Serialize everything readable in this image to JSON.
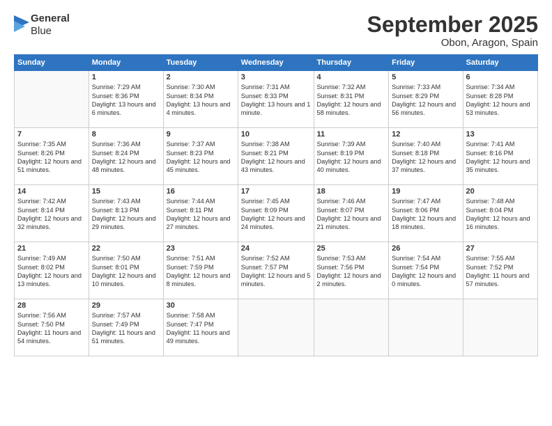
{
  "logo": {
    "line1": "General",
    "line2": "Blue"
  },
  "title": "September 2025",
  "subtitle": "Obon, Aragon, Spain",
  "days": [
    "Sunday",
    "Monday",
    "Tuesday",
    "Wednesday",
    "Thursday",
    "Friday",
    "Saturday"
  ],
  "weeks": [
    [
      {
        "day": "",
        "sunrise": "",
        "sunset": "",
        "daylight": ""
      },
      {
        "day": "1",
        "sunrise": "Sunrise: 7:29 AM",
        "sunset": "Sunset: 8:36 PM",
        "daylight": "Daylight: 13 hours and 6 minutes."
      },
      {
        "day": "2",
        "sunrise": "Sunrise: 7:30 AM",
        "sunset": "Sunset: 8:34 PM",
        "daylight": "Daylight: 13 hours and 4 minutes."
      },
      {
        "day": "3",
        "sunrise": "Sunrise: 7:31 AM",
        "sunset": "Sunset: 8:33 PM",
        "daylight": "Daylight: 13 hours and 1 minute."
      },
      {
        "day": "4",
        "sunrise": "Sunrise: 7:32 AM",
        "sunset": "Sunset: 8:31 PM",
        "daylight": "Daylight: 12 hours and 58 minutes."
      },
      {
        "day": "5",
        "sunrise": "Sunrise: 7:33 AM",
        "sunset": "Sunset: 8:29 PM",
        "daylight": "Daylight: 12 hours and 56 minutes."
      },
      {
        "day": "6",
        "sunrise": "Sunrise: 7:34 AM",
        "sunset": "Sunset: 8:28 PM",
        "daylight": "Daylight: 12 hours and 53 minutes."
      }
    ],
    [
      {
        "day": "7",
        "sunrise": "Sunrise: 7:35 AM",
        "sunset": "Sunset: 8:26 PM",
        "daylight": "Daylight: 12 hours and 51 minutes."
      },
      {
        "day": "8",
        "sunrise": "Sunrise: 7:36 AM",
        "sunset": "Sunset: 8:24 PM",
        "daylight": "Daylight: 12 hours and 48 minutes."
      },
      {
        "day": "9",
        "sunrise": "Sunrise: 7:37 AM",
        "sunset": "Sunset: 8:23 PM",
        "daylight": "Daylight: 12 hours and 45 minutes."
      },
      {
        "day": "10",
        "sunrise": "Sunrise: 7:38 AM",
        "sunset": "Sunset: 8:21 PM",
        "daylight": "Daylight: 12 hours and 43 minutes."
      },
      {
        "day": "11",
        "sunrise": "Sunrise: 7:39 AM",
        "sunset": "Sunset: 8:19 PM",
        "daylight": "Daylight: 12 hours and 40 minutes."
      },
      {
        "day": "12",
        "sunrise": "Sunrise: 7:40 AM",
        "sunset": "Sunset: 8:18 PM",
        "daylight": "Daylight: 12 hours and 37 minutes."
      },
      {
        "day": "13",
        "sunrise": "Sunrise: 7:41 AM",
        "sunset": "Sunset: 8:16 PM",
        "daylight": "Daylight: 12 hours and 35 minutes."
      }
    ],
    [
      {
        "day": "14",
        "sunrise": "Sunrise: 7:42 AM",
        "sunset": "Sunset: 8:14 PM",
        "daylight": "Daylight: 12 hours and 32 minutes."
      },
      {
        "day": "15",
        "sunrise": "Sunrise: 7:43 AM",
        "sunset": "Sunset: 8:13 PM",
        "daylight": "Daylight: 12 hours and 29 minutes."
      },
      {
        "day": "16",
        "sunrise": "Sunrise: 7:44 AM",
        "sunset": "Sunset: 8:11 PM",
        "daylight": "Daylight: 12 hours and 27 minutes."
      },
      {
        "day": "17",
        "sunrise": "Sunrise: 7:45 AM",
        "sunset": "Sunset: 8:09 PM",
        "daylight": "Daylight: 12 hours and 24 minutes."
      },
      {
        "day": "18",
        "sunrise": "Sunrise: 7:46 AM",
        "sunset": "Sunset: 8:07 PM",
        "daylight": "Daylight: 12 hours and 21 minutes."
      },
      {
        "day": "19",
        "sunrise": "Sunrise: 7:47 AM",
        "sunset": "Sunset: 8:06 PM",
        "daylight": "Daylight: 12 hours and 18 minutes."
      },
      {
        "day": "20",
        "sunrise": "Sunrise: 7:48 AM",
        "sunset": "Sunset: 8:04 PM",
        "daylight": "Daylight: 12 hours and 16 minutes."
      }
    ],
    [
      {
        "day": "21",
        "sunrise": "Sunrise: 7:49 AM",
        "sunset": "Sunset: 8:02 PM",
        "daylight": "Daylight: 12 hours and 13 minutes."
      },
      {
        "day": "22",
        "sunrise": "Sunrise: 7:50 AM",
        "sunset": "Sunset: 8:01 PM",
        "daylight": "Daylight: 12 hours and 10 minutes."
      },
      {
        "day": "23",
        "sunrise": "Sunrise: 7:51 AM",
        "sunset": "Sunset: 7:59 PM",
        "daylight": "Daylight: 12 hours and 8 minutes."
      },
      {
        "day": "24",
        "sunrise": "Sunrise: 7:52 AM",
        "sunset": "Sunset: 7:57 PM",
        "daylight": "Daylight: 12 hours and 5 minutes."
      },
      {
        "day": "25",
        "sunrise": "Sunrise: 7:53 AM",
        "sunset": "Sunset: 7:56 PM",
        "daylight": "Daylight: 12 hours and 2 minutes."
      },
      {
        "day": "26",
        "sunrise": "Sunrise: 7:54 AM",
        "sunset": "Sunset: 7:54 PM",
        "daylight": "Daylight: 12 hours and 0 minutes."
      },
      {
        "day": "27",
        "sunrise": "Sunrise: 7:55 AM",
        "sunset": "Sunset: 7:52 PM",
        "daylight": "Daylight: 11 hours and 57 minutes."
      }
    ],
    [
      {
        "day": "28",
        "sunrise": "Sunrise: 7:56 AM",
        "sunset": "Sunset: 7:50 PM",
        "daylight": "Daylight: 11 hours and 54 minutes."
      },
      {
        "day": "29",
        "sunrise": "Sunrise: 7:57 AM",
        "sunset": "Sunset: 7:49 PM",
        "daylight": "Daylight: 11 hours and 51 minutes."
      },
      {
        "day": "30",
        "sunrise": "Sunrise: 7:58 AM",
        "sunset": "Sunset: 7:47 PM",
        "daylight": "Daylight: 11 hours and 49 minutes."
      },
      {
        "day": "",
        "sunrise": "",
        "sunset": "",
        "daylight": ""
      },
      {
        "day": "",
        "sunrise": "",
        "sunset": "",
        "daylight": ""
      },
      {
        "day": "",
        "sunrise": "",
        "sunset": "",
        "daylight": ""
      },
      {
        "day": "",
        "sunrise": "",
        "sunset": "",
        "daylight": ""
      }
    ]
  ]
}
